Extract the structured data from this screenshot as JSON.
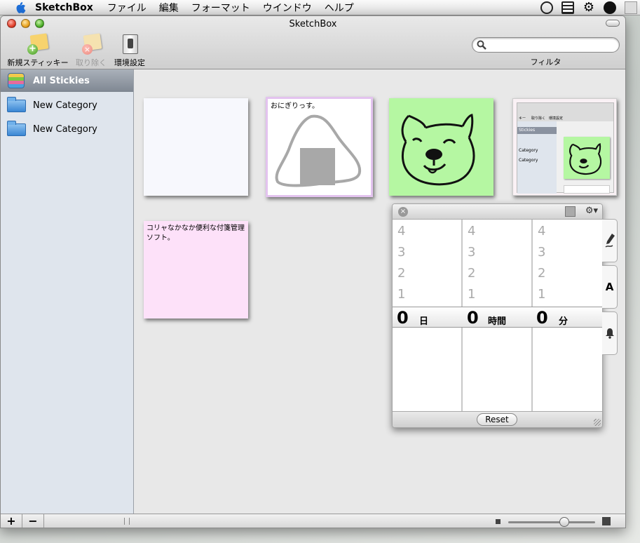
{
  "menubar": {
    "app_name": "SketchBox",
    "menus": [
      "ファイル",
      "編集",
      "フォーマット",
      "ウインドウ",
      "ヘルプ"
    ]
  },
  "window": {
    "title": "SketchBox"
  },
  "toolbar": {
    "new_label": "新規スティッキー",
    "remove_label": "取り除く",
    "prefs_label": "環境設定"
  },
  "search": {
    "value": "",
    "label": "フィルタ"
  },
  "sidebar": {
    "items": [
      {
        "label": "All Stickies",
        "icon": "stickies-stack-icon",
        "selected": true
      },
      {
        "label": "New Category",
        "icon": "folder-icon"
      },
      {
        "label": "New Category",
        "icon": "folder-icon"
      }
    ]
  },
  "stickies": [
    {
      "text": "",
      "color": "#f7f8fd"
    },
    {
      "text": "おにぎりっす。",
      "color": "#ffffff",
      "drawing": "onigiri"
    },
    {
      "text": "",
      "color": "#b5f7a2",
      "drawing": "dog-face"
    },
    {
      "text": "",
      "color": "#faf1f5",
      "drawing": "screenshot-thumbnail",
      "thumb": {
        "t1": "キー",
        "t2": "取り除く",
        "t3": "環境設定",
        "sel": "Stickies",
        "l1": "Category",
        "l2": "Category"
      }
    },
    {
      "text": "コリャなかなか便利な付箋管理ソフト。",
      "color": "#fde1f9"
    }
  ],
  "timer": {
    "columns": [
      {
        "ticks": [
          "4",
          "3",
          "2",
          "1"
        ],
        "value": "0",
        "unit": "日"
      },
      {
        "ticks": [
          "4",
          "3",
          "2",
          "1"
        ],
        "value": "0",
        "unit": "時間"
      },
      {
        "ticks": [
          "4",
          "3",
          "2",
          "1"
        ],
        "value": "0",
        "unit": "分"
      }
    ],
    "reset_label": "Reset",
    "side_tabs": [
      "pen-icon",
      "A",
      "bell-icon"
    ],
    "tab_text_label": "A"
  },
  "bottombar": {
    "add_label": "+",
    "remove_label": "−"
  }
}
